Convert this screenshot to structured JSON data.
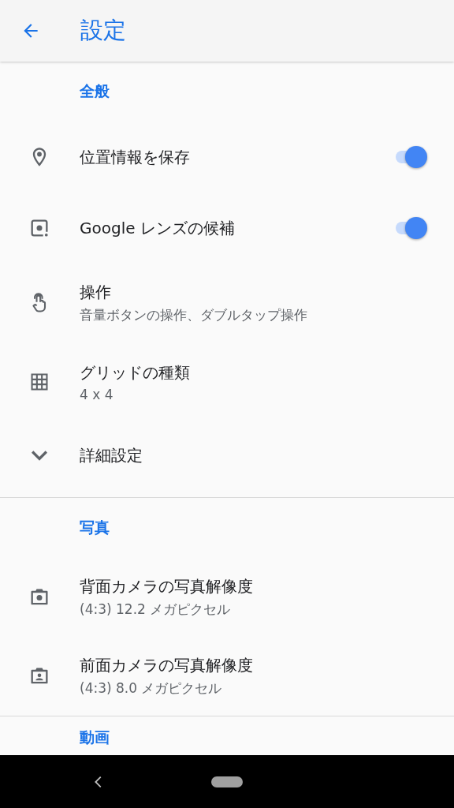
{
  "app_bar": {
    "title": "設定"
  },
  "sections": [
    {
      "header": "全般",
      "items": [
        {
          "kind": "toggle",
          "title": "位置情報を保存",
          "on": true
        },
        {
          "kind": "toggle",
          "title": "Google レンズの候補",
          "on": true
        },
        {
          "kind": "summary",
          "title": "操作",
          "summary": "音量ボタンの操作、ダブルタップ操作"
        },
        {
          "kind": "summary",
          "title": "グリッドの種類",
          "summary": "4 x 4"
        },
        {
          "kind": "expand",
          "title": "詳細設定"
        }
      ]
    },
    {
      "header": "写真",
      "items": [
        {
          "kind": "summary",
          "title": "背面カメラの写真解像度",
          "summary": "(4:3) 12.2 メガピクセル"
        },
        {
          "kind": "summary",
          "title": "前面カメラの写真解像度",
          "summary": "(4:3) 8.0 メガピクセル"
        }
      ]
    },
    {
      "header": "動画"
    }
  ]
}
